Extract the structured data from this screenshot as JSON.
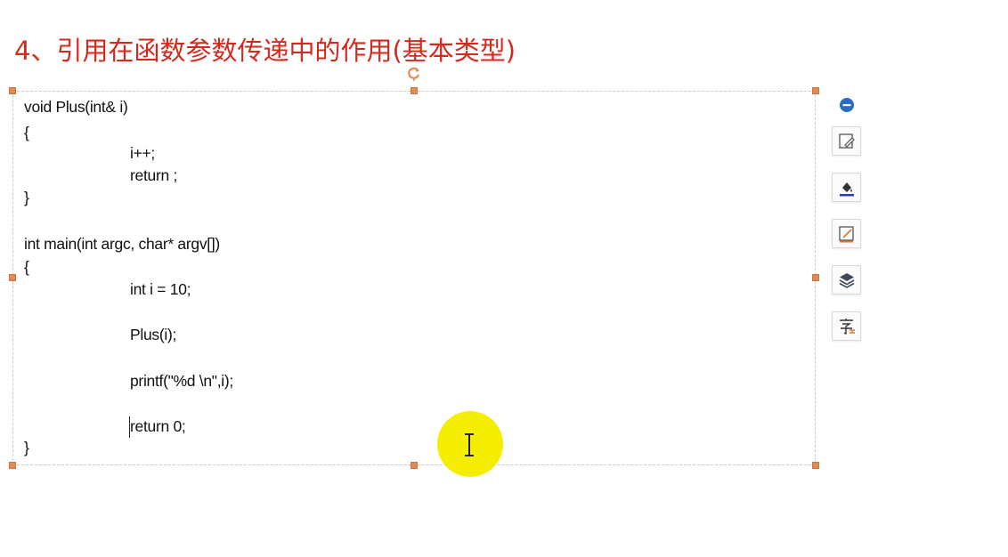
{
  "slide": {
    "title": "4、引用在函数参数传递中的作用(基本类型)"
  },
  "code": {
    "lines": [
      "void Plus(int& i)",
      "{",
      "i++;",
      "return ;",
      "}",
      "int main(int argc, char* argv[])",
      "{",
      "int i = 10;",
      "Plus(i);",
      "printf(\"%d \\n\",i);",
      "return 0;",
      "}"
    ]
  },
  "toolbar": {
    "icons": [
      "collapse-icon",
      "edit-shape-icon",
      "fill-color-icon",
      "outline-icon",
      "layers-icon",
      "text-style-icon"
    ]
  },
  "colors": {
    "title": "#d42a1e",
    "handle": "#e28a55",
    "accent_blue": "#2b6cc4",
    "highlight": "#f6ee00"
  }
}
